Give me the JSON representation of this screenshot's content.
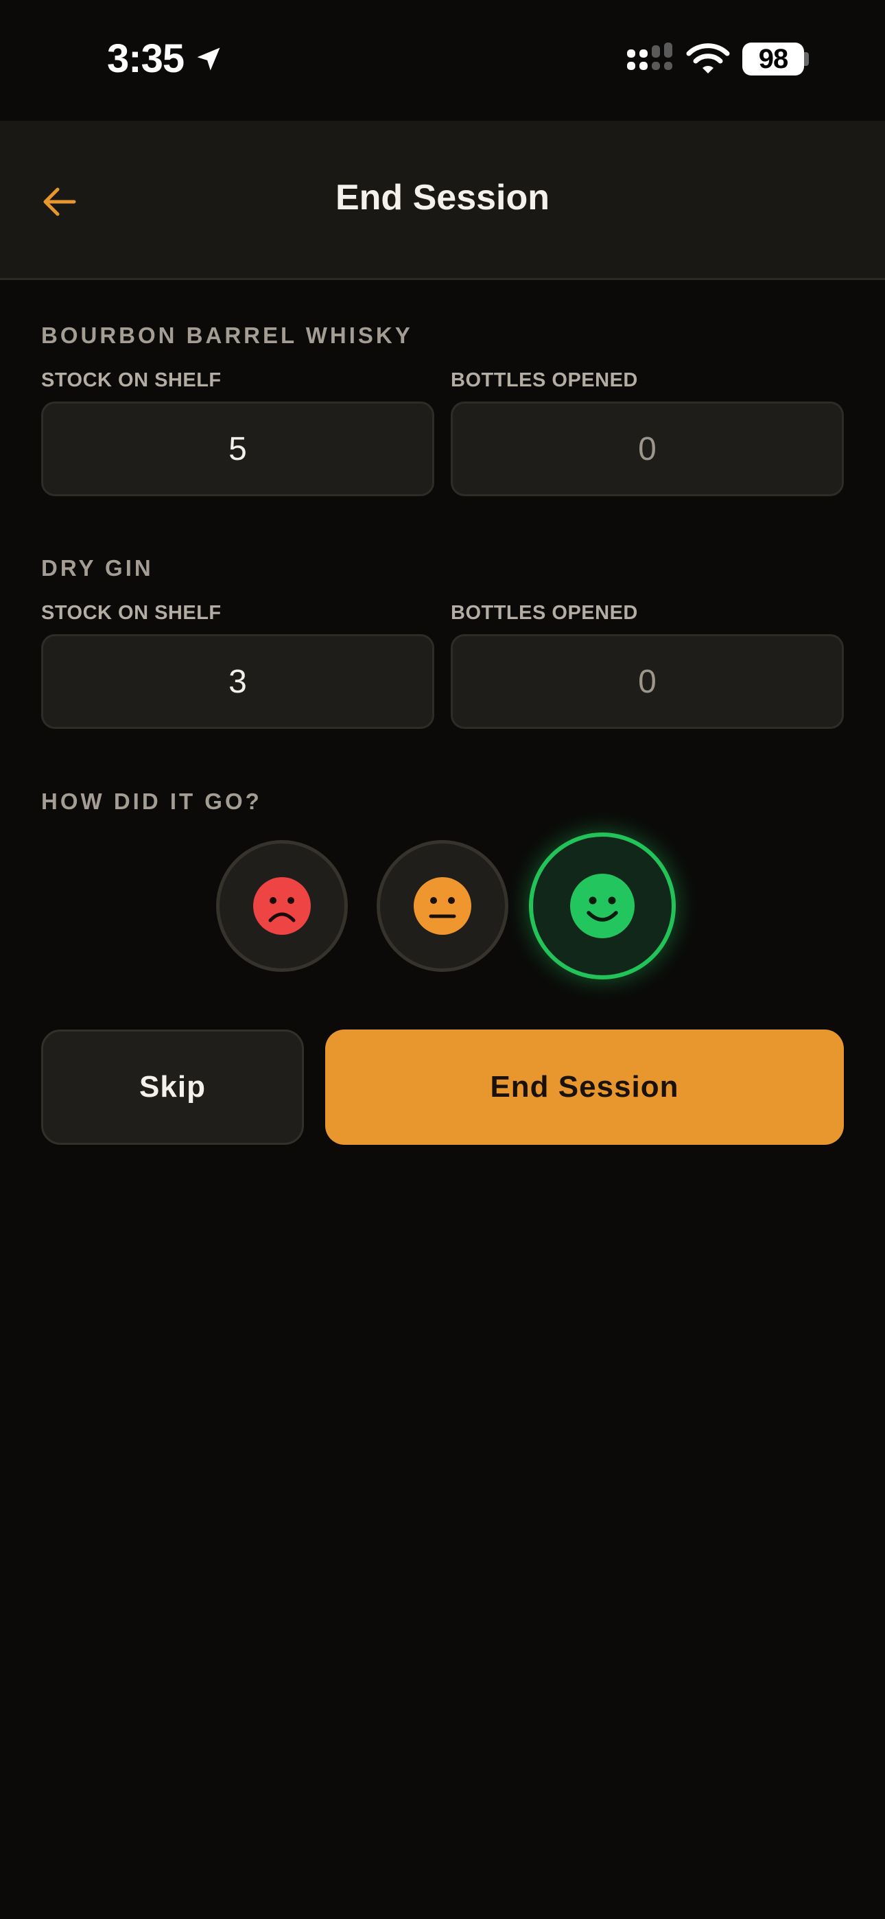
{
  "status_bar": {
    "time": "3:35",
    "battery": "98",
    "icons": [
      "location-arrow-icon",
      "cellular-signal-icon",
      "wifi-icon",
      "battery-icon"
    ]
  },
  "header": {
    "title": "End Session",
    "back_icon": "arrow-left-icon"
  },
  "products": [
    {
      "name": "BOURBON BARREL WHISKY",
      "stock_label": "STOCK ON SHELF",
      "stock_value": "5",
      "opened_label": "BOTTLES OPENED",
      "opened_value": "0"
    },
    {
      "name": "DRY GIN",
      "stock_label": "STOCK ON SHELF",
      "stock_value": "3",
      "opened_label": "BOTTLES OPENED",
      "opened_value": "0"
    }
  ],
  "mood": {
    "title": "HOW DID IT GO?",
    "options": [
      {
        "icon": "sad-face-icon",
        "color": "#ef4444",
        "selected": false
      },
      {
        "icon": "neutral-face-icon",
        "color": "#f0962e",
        "selected": false
      },
      {
        "icon": "happy-face-icon",
        "color": "#22c55e",
        "selected": true
      }
    ]
  },
  "actions": {
    "skip_label": "Skip",
    "end_label": "End Session"
  },
  "colors": {
    "accent": "#e8962e",
    "background": "#0b0a09",
    "success": "#22c55e"
  }
}
